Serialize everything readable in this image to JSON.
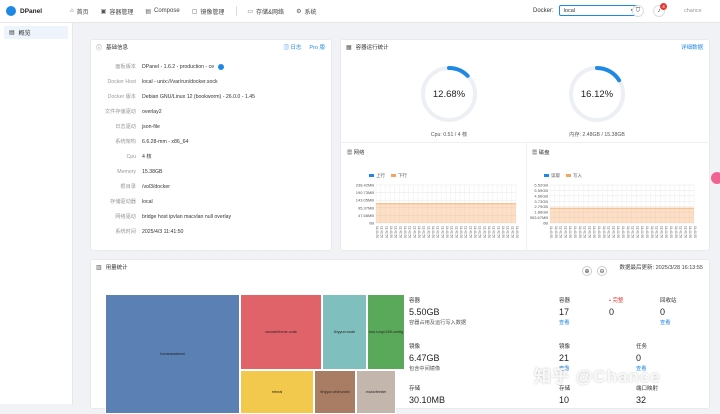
{
  "app": {
    "title": "DPanel"
  },
  "nav": [
    {
      "icon": "home-icon",
      "glyph": "⌂",
      "label": "首页"
    },
    {
      "icon": "container-icon",
      "glyph": "▣",
      "label": "容器管理"
    },
    {
      "icon": "compose-icon",
      "glyph": "▤",
      "label": "Compose"
    },
    {
      "icon": "image-icon",
      "glyph": "▢",
      "label": "镜像管理"
    },
    {
      "icon": "storage-icon",
      "glyph": "▭",
      "label": "存储&网络"
    },
    {
      "icon": "system-icon",
      "glyph": "⚙",
      "label": "系统"
    }
  ],
  "docker": {
    "label": "Docker:",
    "value": "local"
  },
  "notifications": {
    "count": "4"
  },
  "user": {
    "name": "chance"
  },
  "sidebar": {
    "items": [
      {
        "label": "概览"
      }
    ]
  },
  "basic_info": {
    "title": "基础信息",
    "log_label": "日志",
    "pro_label": "Pro 版",
    "rows": [
      {
        "k": "面板版本",
        "v": "DPanel - 1.6.2 - production - ce"
      },
      {
        "k": "Docker Host",
        "v": "local - unix:///var/run/docker.sock"
      },
      {
        "k": "Docker 版本",
        "v": "Debian GNU/Linux 12 (bookworm) - 26.0.0 - 1.45"
      },
      {
        "k": "文件存储驱动",
        "v": "overlay2"
      },
      {
        "k": "日志驱动",
        "v": "json-file"
      },
      {
        "k": "系统架构",
        "v": "6.6.28-mm - x86_64"
      },
      {
        "k": "Cpu",
        "v": "4 核"
      },
      {
        "k": "Memory",
        "v": "15.38GB"
      },
      {
        "k": "根目录",
        "v": "/vol3/docker"
      },
      {
        "k": "存储驱动器",
        "v": "local"
      },
      {
        "k": "网络驱动",
        "v": "bridge  host  ipvlan  macvlan  null  overlay"
      },
      {
        "k": "系统时间",
        "v": "2025/4/3 11:41:50"
      }
    ]
  },
  "runtime": {
    "title": "容器运行统计",
    "detail_label": "详细数据",
    "cpu": {
      "percent": 12.68,
      "label": "12.68%",
      "caption": "Cpu: 0.51 / 4 核",
      "color": "#1e88e5"
    },
    "mem": {
      "percent": 16.12,
      "label": "16.12%",
      "caption": "内存: 2.48GB / 15.38GB",
      "color": "#1e88e5"
    }
  },
  "network": {
    "title": "网络",
    "legend": [
      "上行",
      "下行"
    ],
    "colors": [
      "#1e88e5",
      "#f5a45d"
    ],
    "ticks": [
      "238.42MB",
      "190.73MB",
      "143.05MB",
      "95.37MB",
      "47.68MB",
      "0B"
    ],
    "xlabel": "11:41:50"
  },
  "disk": {
    "title": "磁盘",
    "legend": [
      "读取",
      "写入"
    ],
    "colors": [
      "#1e88e5",
      "#f5a45d"
    ],
    "ticks": [
      "6.52GB",
      "5.59GB",
      "4.66GB",
      "3.73GB",
      "2.79GB",
      "1.86GB",
      "953.67MB",
      "0B"
    ],
    "xlabel": "11:41:50"
  },
  "usage": {
    "title": "用量统计",
    "updated_label": "数据最后更新: 2025/3/28 16:13:55",
    "stats": [
      {
        "t": "容器",
        "n": "5.50GB",
        "s": "容器占用及运行写入数据"
      },
      {
        "t": "容器",
        "n": "17",
        "l": "查看"
      },
      {
        "t": "• 完整",
        "n": "0"
      },
      {
        "t": "回收站",
        "n": "0",
        "l": "查看"
      },
      {
        "t": "镜像",
        "n": "6.47GB",
        "s": "包含中间镜像"
      },
      {
        "t": "镜像",
        "n": "21",
        "l": "查看"
      },
      {
        "t": "任务",
        "n": "0",
        "l": "查看"
      },
      {
        "t": "存储",
        "n": "30.10MB"
      },
      {
        "t": "存储",
        "n": "10"
      },
      {
        "t": "端口映射",
        "n": "32"
      }
    ],
    "treemap": [
      {
        "label": "homeassistant",
        "color": "#5b80b3"
      },
      {
        "label": "vscode/home.code",
        "color": "#e0636a"
      },
      {
        "label": "tinyyun:node",
        "color": "#7fbfbd"
      },
      {
        "label": "tool-ruoyi:169.config",
        "color": "#5aa85a"
      },
      {
        "label": "rebeal",
        "color": "#f2c94c"
      },
      {
        "label": "tinyyun:zhihumini",
        "color": "#a87d63"
      },
      {
        "label": "musicfeeder",
        "color": "#c3b6ad"
      }
    ]
  },
  "watermark": "知乎 @Chance"
}
